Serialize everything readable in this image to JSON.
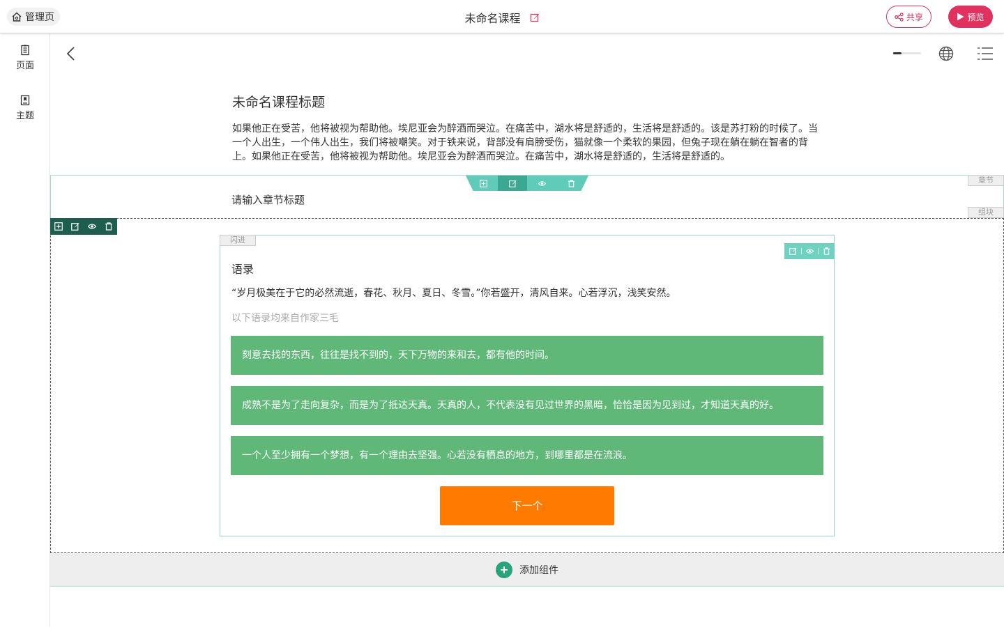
{
  "topbar": {
    "home_label": "管理页",
    "course_title": "未命名课程",
    "share_label": "共享",
    "preview_label": "预览"
  },
  "sidebar": {
    "items": [
      {
        "label": "页面",
        "icon": "page-icon"
      },
      {
        "label": "主题",
        "icon": "theme-icon"
      }
    ]
  },
  "toolbar": {
    "progress": 0.3
  },
  "course": {
    "heading": "未命名课程标题",
    "description": "如果他正在受苦，他将被视为帮助他。埃尼亚会为醉酒而哭泣。在痛苦中，湖水将是舒适的，生活将是舒适的。该是苏打粉的时候了。当一个人出生，一个伟人出生，我们将被嘲笑。对于铁来说，背部没有肩膀受伤，猫就像一个柔软的果园，但兔子现在躺在躺在智者的背上。如果他正在受苦，他将被视为帮助他。埃尼亚会为醉酒而哭泣。在痛苦中，湖水将是舒适的，生活将是舒适的。"
  },
  "chapter": {
    "title": "请输入章节标题",
    "tag": "章节",
    "block_tag": "组块"
  },
  "card": {
    "tag": "闪进",
    "title": "语录",
    "text": "“岁月极美在于它的必然流逝，春花、秋月、夏日、冬雪。”你若盛开，清风自来。心若浮沉，浅笑安然。",
    "source": "以下语录均来自作家三毛",
    "quotes": [
      "刻意去找的东西，往往是找不到的，天下万物的来和去，都有他的时间。",
      "成熟不是为了走向复杂，而是为了抵达天真。天真的人，不代表没有见过世界的黑暗，恰恰是因为见到过，才知道天真的好。",
      "一个人至少拥有一个梦想，有一个理由去坚强。心若没有栖息的地方，到哪里都是在流浪。"
    ],
    "next_label": "下一个"
  },
  "add_bar": {
    "label": "添加组件"
  },
  "colors": {
    "accent": "#e0315f",
    "teal": "#5fcbb8",
    "green": "#5fb878",
    "orange": "#ff7a00"
  }
}
